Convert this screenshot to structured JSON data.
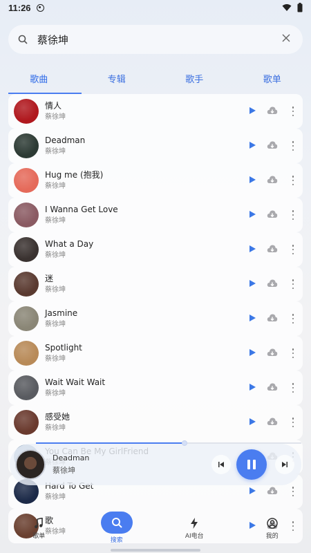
{
  "status": {
    "time": "11:26"
  },
  "search": {
    "query": "蔡徐坤"
  },
  "tabs": [
    {
      "label": "歌曲"
    },
    {
      "label": "专辑"
    },
    {
      "label": "歌手"
    },
    {
      "label": "歌单"
    }
  ],
  "songs": [
    {
      "title": "情人",
      "artist": "蔡徐坤",
      "cover": "#b0181e"
    },
    {
      "title": "Deadman",
      "artist": "蔡徐坤",
      "cover": "#2c3a34"
    },
    {
      "title": "Hug me (抱我)",
      "artist": "蔡徐坤",
      "cover": "#e56a5a"
    },
    {
      "title": "I Wanna Get Love",
      "artist": "蔡徐坤",
      "cover": "#8a5a62"
    },
    {
      "title": "What a Day",
      "artist": "蔡徐坤",
      "cover": "#3a3230"
    },
    {
      "title": "迷",
      "artist": "蔡徐坤",
      "cover": "#5a3a30"
    },
    {
      "title": "Jasmine",
      "artist": "蔡徐坤",
      "cover": "#8a8676"
    },
    {
      "title": "Spotlight",
      "artist": "蔡徐坤",
      "cover": "#b88a58"
    },
    {
      "title": "Wait Wait Wait",
      "artist": "蔡徐坤",
      "cover": "#595b60"
    },
    {
      "title": "感受她",
      "artist": "蔡徐坤",
      "cover": "#6a3a2e"
    },
    {
      "title": "You Can Be My GirlFriend",
      "artist": "蔡徐坤",
      "cover": "#7a96b4"
    },
    {
      "title": "Hard To Get",
      "artist": "蔡徐坤",
      "cover": "#1c2a48"
    },
    {
      "title": "歌",
      "artist": "蔡徐坤",
      "cover": "#6a4030"
    }
  ],
  "player": {
    "title": "Deadman",
    "artist": "蔡徐坤",
    "progress": 0.56
  },
  "nav": [
    {
      "label": "歌单",
      "icon": "music-note-icon"
    },
    {
      "label": "搜索",
      "icon": "search-icon"
    },
    {
      "label": "AI电台",
      "icon": "bolt-icon"
    },
    {
      "label": "我的",
      "icon": "user-icon"
    }
  ],
  "colors": {
    "accent": "#4a7df0"
  }
}
